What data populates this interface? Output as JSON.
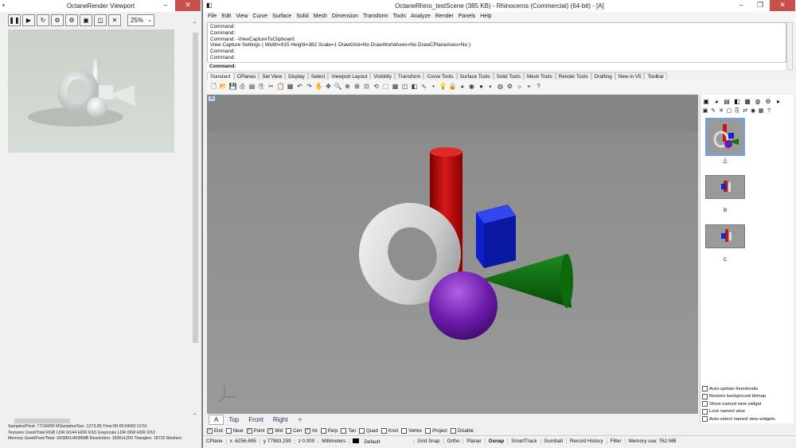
{
  "octane": {
    "title": "OctaneRender Viewport",
    "toolbar": [
      "❚❚",
      "▶",
      "↻",
      "⚙",
      "⚙",
      "▣",
      "◫",
      "✕"
    ],
    "zoom": "25%",
    "status_lines": [
      "Samples/Pixel: 77/16000   MSamples/Sec: 1273.85   Time:00:00:04/00:13:51",
      "Textures Used/Total RGB LDR 0/144  HDR 0/10   Grayscale LDR 0/68  HDR 0/10",
      "Memory Used/Free/Total: 39/3891/4095MB  Resolution: 1600x1200  Triangles: 18732  Meshes:"
    ]
  },
  "rhino": {
    "title": "OctaneRhino_testScene (385 KB) - Rhinoceros (Commercial) (64-bit) - [A]",
    "menu": [
      "File",
      "Edit",
      "View",
      "Curve",
      "Surface",
      "Solid",
      "Mesh",
      "Dimension",
      "Transform",
      "Tools",
      "Analyze",
      "Render",
      "Panels",
      "Help"
    ],
    "command_lines": [
      "Command:",
      "Command:",
      "Command: -ViewCaptureToClipboard",
      "View Capture Settings ( Width=915  Height=382  Scale=1  DrawGrid=No  DrawWorldAxes=No  DrawCPlaneAxes=No ):",
      "Command:",
      "Command:"
    ],
    "command_prompt": "Command:",
    "toolbar_tabs": [
      "Standard",
      "CPlanes",
      "Set View",
      "Display",
      "Select",
      "Viewport Layout",
      "Visibility",
      "Transform",
      "Curve Tools",
      "Surface Tools",
      "Solid Tools",
      "Mesh Tools",
      "Render Tools",
      "Drafting",
      "New in V5",
      "Toolbar"
    ],
    "active_tab": "Standard",
    "viewport_label": "A",
    "view_tabs": [
      "A",
      "Top",
      "Front",
      "Right",
      "✧"
    ],
    "osnap": [
      {
        "label": "End",
        "checked": true
      },
      {
        "label": "Near",
        "checked": false
      },
      {
        "label": "Point",
        "checked": true
      },
      {
        "label": "Mid",
        "checked": true
      },
      {
        "label": "Cen",
        "checked": false
      },
      {
        "label": "Int",
        "checked": true
      },
      {
        "label": "Perp",
        "checked": false
      },
      {
        "label": "Tan",
        "checked": false
      },
      {
        "label": "Quad",
        "checked": false
      },
      {
        "label": "Knot",
        "checked": false
      },
      {
        "label": "Vertex",
        "checked": false
      },
      {
        "label": "Project",
        "checked": false
      },
      {
        "label": "Disable",
        "checked": false
      }
    ],
    "status": {
      "cplane": "CPlane",
      "x": "x -6256.695",
      "y": "y 77983.259",
      "z": "z 0.000",
      "units": "Millimeters",
      "layer": "Default",
      "toggles": [
        "Grid Snap",
        "Ortho",
        "Planar",
        "Osnap",
        "SmartTrack",
        "Gumball",
        "Record History",
        "Filter"
      ],
      "memory": "Memory use: 762 MB"
    },
    "named_views": [
      {
        "label": "A"
      },
      {
        "label": "B"
      },
      {
        "label": "C"
      }
    ],
    "panel_options": [
      "Auto-update thumbnails",
      "Restore background bitmap",
      "Show named view widget",
      "Lock named view",
      "Auto-select named view widgets"
    ]
  }
}
